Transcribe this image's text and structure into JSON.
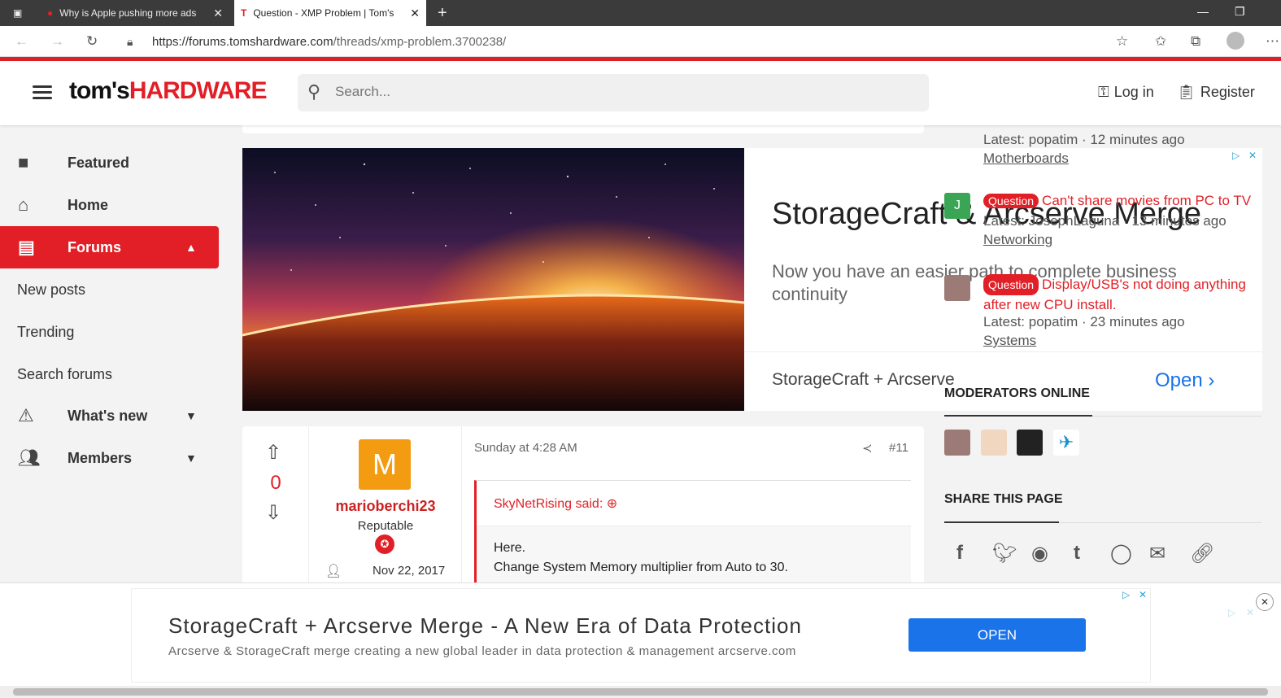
{
  "browser": {
    "tabs": [
      {
        "title": "Why is Apple pushing more ads"
      },
      {
        "title": "Question - XMP Problem | Tom's"
      }
    ],
    "url_host": "https://forums.tomshardware.com",
    "url_path": "/threads/xmp-problem.3700238/"
  },
  "header": {
    "logo_left": "tom's",
    "logo_right": "HARDWARE",
    "search_placeholder": "Search...",
    "login": "Log in",
    "register": "Register"
  },
  "nav": {
    "featured": "Featured",
    "home": "Home",
    "forums": "Forums",
    "new_posts": "New posts",
    "trending": "Trending",
    "search_forums": "Search forums",
    "whats_new": "What's new",
    "members": "Members"
  },
  "ad": {
    "title": "StorageCraft & Arcserve Merge",
    "subtitle": "Now you have an easier path to complete business continuity",
    "footer_label": "StorageCraft + Arcserve",
    "open": "Open"
  },
  "post": {
    "votes": "0",
    "avatar_letter": "M",
    "username": "marioberchi23",
    "user_title": "Reputable",
    "joined": "Nov 22, 2017",
    "date": "Sunday at 4:28 AM",
    "number": "#11",
    "quote_author": "SkyNetRising said:",
    "quote_line1": "Here.",
    "quote_line2": "Change System Memory multiplier from Auto to 30."
  },
  "sidebar": {
    "latest1": "Latest: popatim · 12 minutes ago",
    "forum1": "Motherboards",
    "avatar2_letter": "J",
    "badge": "Question",
    "thread2": "Can't share movies from PC to TV",
    "latest2": "Latest: JosephLaguna · 13 minutes ago",
    "forum2": "Networking",
    "thread3": "Display/USB's not doing anything after new CPU install.",
    "latest3": "Latest: popatim · 23 minutes ago",
    "forum3": "Systems",
    "moderators_heading": "MODERATORS ONLINE",
    "share_heading": "SHARE THIS PAGE"
  },
  "bottom_ad": {
    "title": "StorageCraft + Arcserve Merge - A New Era of Data Protection",
    "subtitle": "Arcserve & StorageCraft merge creating a new global leader in data protection & management arcserve.com",
    "button": "OPEN"
  },
  "colors": {
    "brand_red": "#e21f26",
    "ad_blue": "#1a73e8"
  }
}
